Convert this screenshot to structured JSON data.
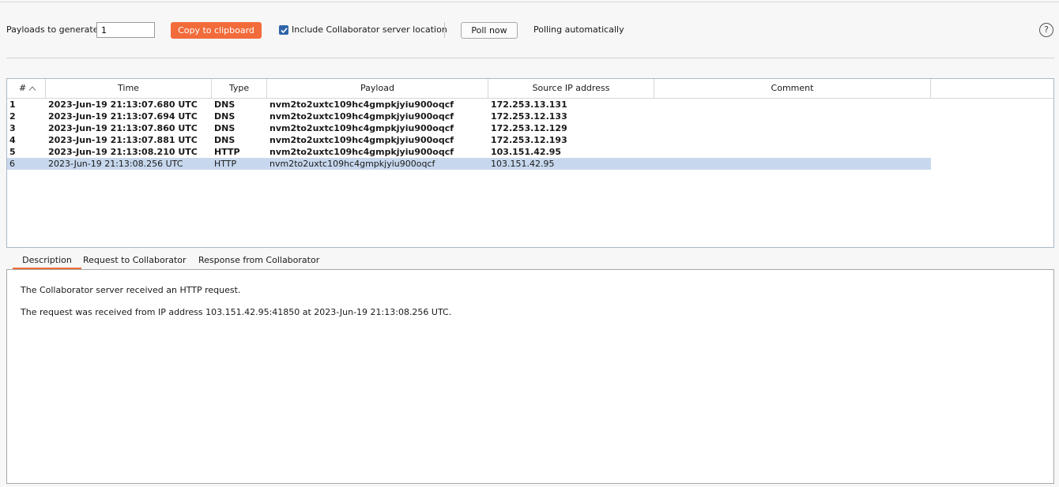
{
  "toolbar": {
    "payloads_label": "Payloads to generate:",
    "payloads_value": "1",
    "copy_button": "Copy to clipboard",
    "include_checkbox_label": "Include Collaborator server location",
    "include_checked": true,
    "poll_button": "Poll now",
    "polling_status": "Polling automatically",
    "help_icon": "?"
  },
  "table": {
    "columns": [
      "#",
      "Time",
      "Type",
      "Payload",
      "Source IP address",
      "Comment"
    ],
    "rows": [
      {
        "num": "1",
        "time": "2023-Jun-19 21:13:07.680 UTC",
        "type": "DNS",
        "payload": "nvm2to2uxtc109hc4gmpkjyiu900oqcf",
        "ip": "172.253.13.131",
        "comment": "",
        "unread": true
      },
      {
        "num": "2",
        "time": "2023-Jun-19 21:13:07.694 UTC",
        "type": "DNS",
        "payload": "nvm2to2uxtc109hc4gmpkjyiu900oqcf",
        "ip": "172.253.12.133",
        "comment": "",
        "unread": true
      },
      {
        "num": "3",
        "time": "2023-Jun-19 21:13:07.860 UTC",
        "type": "DNS",
        "payload": "nvm2to2uxtc109hc4gmpkjyiu900oqcf",
        "ip": "172.253.12.129",
        "comment": "",
        "unread": true
      },
      {
        "num": "4",
        "time": "2023-Jun-19 21:13:07.881 UTC",
        "type": "DNS",
        "payload": "nvm2to2uxtc109hc4gmpkjyiu900oqcf",
        "ip": "172.253.12.193",
        "comment": "",
        "unread": true
      },
      {
        "num": "5",
        "time": "2023-Jun-19 21:13:08.210 UTC",
        "type": "HTTP",
        "payload": "nvm2to2uxtc109hc4gmpkjyiu900oqcf",
        "ip": "103.151.42.95",
        "comment": "",
        "unread": true
      },
      {
        "num": "6",
        "time": "2023-Jun-19 21:13:08.256 UTC",
        "type": "HTTP",
        "payload": "nvm2to2uxtc109hc4gmpkjyiu900oqcf",
        "ip": "103.151.42.95",
        "comment": "",
        "unread": false,
        "selected": true
      }
    ]
  },
  "tabs": [
    "Description",
    "Request to Collaborator",
    "Response from Collaborator"
  ],
  "description": {
    "line1": "The Collaborator server received an HTTP request.",
    "line2": "The request was received from IP address 103.151.42.95:41850 at 2023-Jun-19 21:13:08.256 UTC."
  },
  "colors": {
    "accent": "#f26b3a",
    "selection": "#c7d8ee",
    "checkbox": "#2f65a8"
  }
}
